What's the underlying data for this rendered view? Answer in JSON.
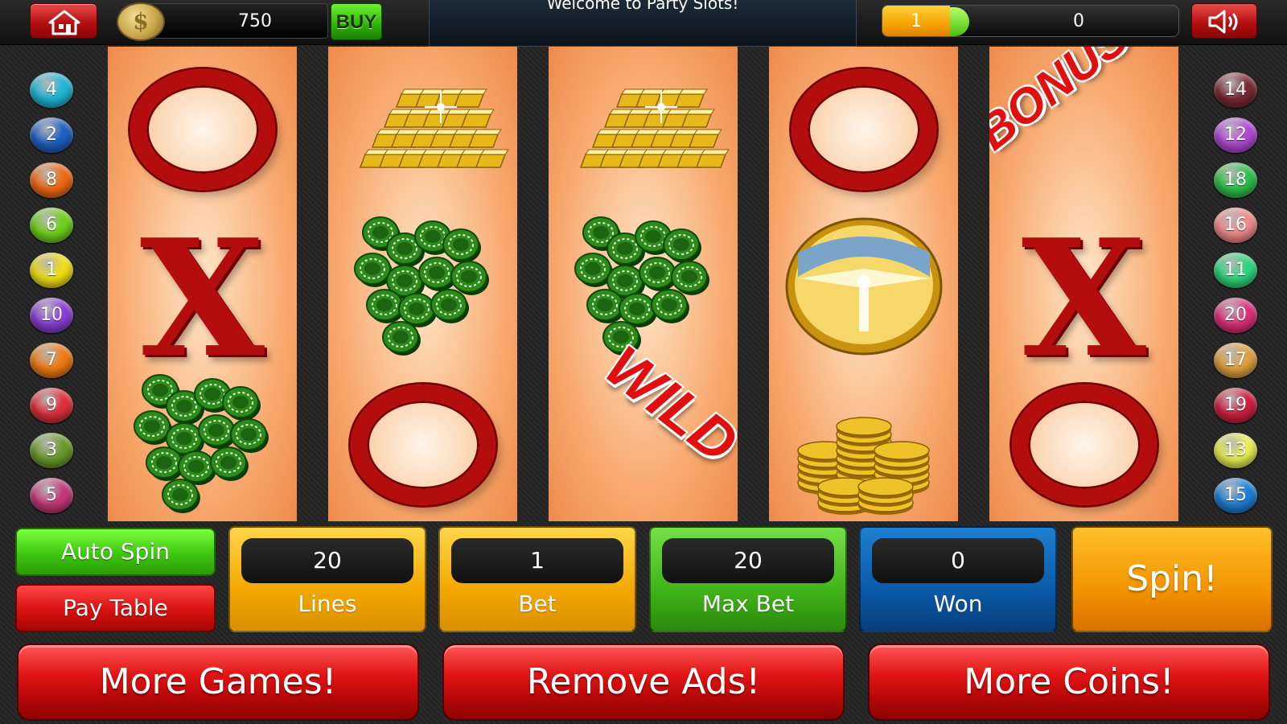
{
  "top_bar": {
    "coin_balance": "750",
    "buy_label": "BUY",
    "welcome_message": "Welcome to Party Slots!",
    "level": "1",
    "xp_value": "0",
    "xp_progress": 0.05
  },
  "paylines": {
    "left": [
      "4",
      "2",
      "8",
      "6",
      "1",
      "10",
      "7",
      "9",
      "3",
      "5"
    ],
    "right": [
      "14",
      "12",
      "18",
      "16",
      "11",
      "20",
      "17",
      "19",
      "13",
      "15"
    ],
    "left_colors": [
      "#1fb7d6",
      "#1f5fc2",
      "#f06a14",
      "#6fd11c",
      "#f0e014",
      "#8a3fd6",
      "#f07a14",
      "#e0303c",
      "#6a9a2a",
      "#c23a78"
    ],
    "right_colors": [
      "#7a2a34",
      "#b04ad6",
      "#2fc24a",
      "#f08a8a",
      "#2fd67a",
      "#e0307a",
      "#e0a040",
      "#d02040",
      "#e8f050",
      "#1f7fd6"
    ]
  },
  "reels": [
    [
      "O",
      "X",
      "chips"
    ],
    [
      "gold-bars",
      "chips",
      "O"
    ],
    [
      "gold-bars",
      "chips",
      "WILD"
    ],
    [
      "O",
      "gold-plate",
      "gold-coins"
    ],
    [
      "BONUS",
      "X",
      "O"
    ]
  ],
  "controls": {
    "auto_spin_label": "Auto Spin",
    "pay_table_label": "Pay Table",
    "lines": {
      "value": "20",
      "label": "Lines"
    },
    "bet": {
      "value": "1",
      "label": "Bet"
    },
    "max_bet": {
      "value": "20",
      "label": "Max Bet"
    },
    "won": {
      "value": "0",
      "label": "Won"
    },
    "spin_label": "Spin!",
    "more_games_label": "More Games!",
    "remove_ads_label": "Remove Ads!",
    "more_coins_label": "More Coins!"
  },
  "icons": {
    "home": "home-icon",
    "coin": "coin-icon",
    "sound": "speaker-icon"
  }
}
